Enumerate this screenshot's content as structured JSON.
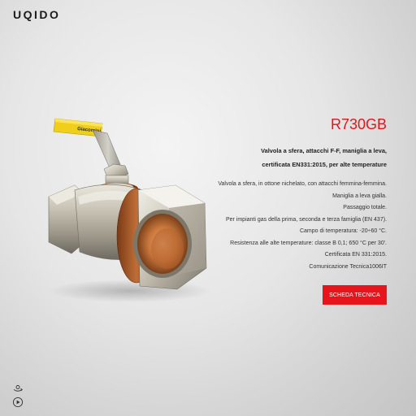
{
  "header": {
    "brand": "UQIDO"
  },
  "product": {
    "code": "R730GB",
    "subtitle_lines": [
      "Valvola a sfera, attacchi F-F, maniglia a leva,",
      "certificata EN331:2015, per alte temperature"
    ],
    "description_lines": [
      "Valvola a sfera, in ottone nichelato, con attacchi femmina-femmina.",
      "Maniglia a leva gialla.",
      "Passaggio totale.",
      "Per impianti gas della prima, seconda e terza famiglia (EN 437).",
      "Campo di temperatura: -20÷60 °C.",
      "Resistenza alle alte temperature: classe B 0,1; 650 °C per 30'.",
      "Certificata EN 331:2015.",
      "Comunicazione Tecnica1006IT"
    ],
    "handle_text": "Giacomini",
    "cta_label": "SCHEDA TECNICA"
  },
  "controls": {
    "rotate_icon": "rotate-360-icon",
    "play_icon": "play-icon"
  },
  "colors": {
    "accent": "#e3141b",
    "handle": "#f0cf1a",
    "brass": "#b8642c",
    "nickel": "#cfcabd"
  }
}
